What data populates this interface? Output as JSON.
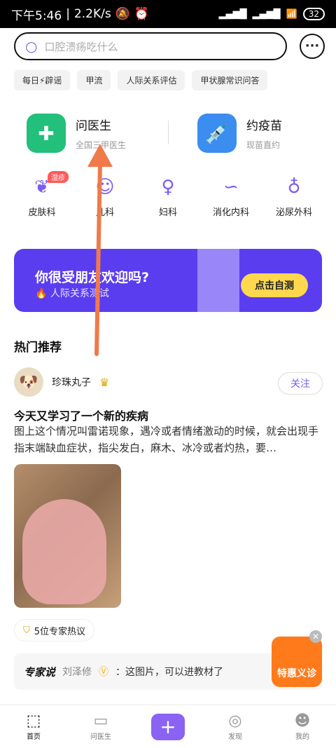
{
  "status_bar": {
    "time": "下午5:46",
    "speed": "2.2K/s",
    "battery": "32"
  },
  "search": {
    "placeholder": "口腔溃疡吃什么"
  },
  "quick_tags": [
    "每日⚡辟谣",
    "甲流",
    "人际关系评估",
    "甲状腺常识问答"
  ],
  "features": [
    {
      "title": "问医生",
      "subtitle": "全国三甲医生"
    },
    {
      "title": "约疫苗",
      "subtitle": "现苗直约"
    }
  ],
  "departments": [
    {
      "label": "皮肤科",
      "badge": "湿疹"
    },
    {
      "label": "儿科"
    },
    {
      "label": "妇科"
    },
    {
      "label": "消化内科"
    },
    {
      "label": "泌尿外科"
    }
  ],
  "banner": {
    "title": "你很受朋友欢迎吗?",
    "subtitle": "人际关系测试",
    "button": "点击自测"
  },
  "section_title": "热门推荐",
  "post": {
    "author": "珍珠丸子",
    "follow": "关注",
    "title": "今天又学习了一个新的疾病",
    "body": "图上这个情况叫雷诺现象，遇冷或者情绪激动的时候，就会出现手指末端缺血症状，指尖发白，麻木、冰冷或者灼热，要…",
    "expert_count": "5位专家热议",
    "expert_label": "专家说",
    "expert_name": "刘泽修",
    "expert_comment": "：这图片，可以进教材了"
  },
  "promo": {
    "label": "特惠义诊"
  },
  "tabs": [
    {
      "label": "首页"
    },
    {
      "label": "问医生"
    },
    {
      "label": ""
    },
    {
      "label": "发现"
    },
    {
      "label": "我的"
    }
  ],
  "colors": {
    "accent": "#7c5cf6",
    "banner": "#5b3df0",
    "cta": "#ffd84d",
    "promo": "#ff7a1a"
  }
}
